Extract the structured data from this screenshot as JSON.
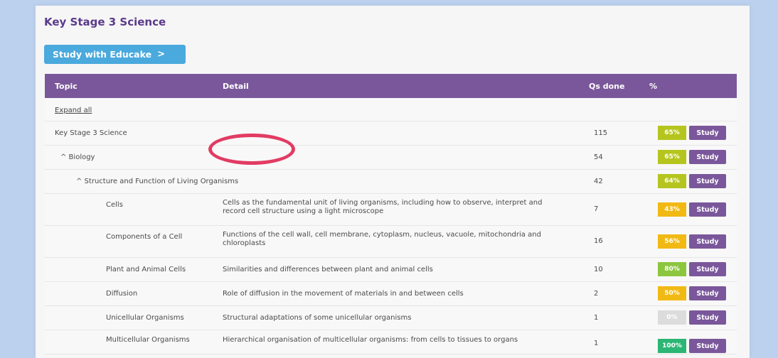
{
  "title": "Key Stage 3 Science",
  "study_button": {
    "label": "Study with Educake",
    "chevron": ">"
  },
  "table": {
    "headers": {
      "topic": "Topic",
      "detail": "Detail",
      "qs_done": "Qs done",
      "percent": "%"
    },
    "expand_all": "Expand all",
    "study_label": "Study",
    "rows": [
      {
        "topic": "Key Stage 3 Science",
        "detail": "",
        "qs": "115",
        "pct": "65%",
        "pct_color": "#b5c51e",
        "level": 0
      },
      {
        "topic": "^ Biology",
        "detail": "",
        "qs": "54",
        "pct": "65%",
        "pct_color": "#b5c51e",
        "level": 1
      },
      {
        "topic": "^ Structure and Function of Living Organisms",
        "detail": "",
        "qs": "42",
        "pct": "64%",
        "pct_color": "#b5c51e",
        "level": 2
      },
      {
        "topic": "Cells",
        "detail": "Cells as the fundamental unit of living organisms, including how to observe, interpret and record cell structure using a light microscope",
        "qs": "7",
        "pct": "43%",
        "pct_color": "#f1b914",
        "level": 3
      },
      {
        "topic": "Components of a Cell",
        "detail": "Functions of the cell wall, cell membrane, cytoplasm, nucleus, vacuole, mitochondria and chloroplasts",
        "qs": "16",
        "pct": "56%",
        "pct_color": "#f1b914",
        "level": 3
      },
      {
        "topic": "Plant and Animal Cells",
        "detail": "Similarities and differences between plant and animal cells",
        "qs": "10",
        "pct": "80%",
        "pct_color": "#8cc63f",
        "level": 3
      },
      {
        "topic": "Diffusion",
        "detail": "Role of diffusion in the movement of materials in and between cells",
        "qs": "2",
        "pct": "50%",
        "pct_color": "#f1b914",
        "level": 3
      },
      {
        "topic": "Unicellular Organisms",
        "detail": "Structural adaptations of some unicellular organisms",
        "qs": "1",
        "pct": "0%",
        "pct_color": "#dcdcdc",
        "level": 3
      },
      {
        "topic": "Multicellular Organisms",
        "detail": "Hierarchical organisation of multicellular organisms: from cells to tissues to organs",
        "qs": "1",
        "pct": "100%",
        "pct_color": "#2bb673",
        "level": 3
      }
    ]
  },
  "annotation": {
    "color": "#e23b63"
  }
}
